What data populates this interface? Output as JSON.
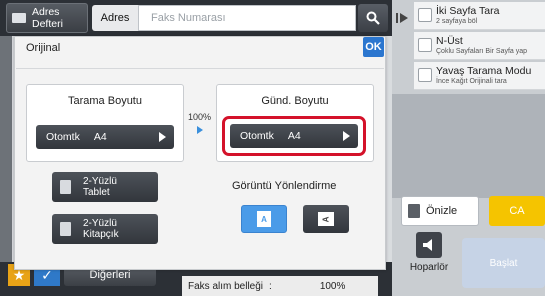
{
  "topbar": {
    "address_book_label": "Adres Defteri",
    "address_book_line1": "Adres",
    "address_book_line2": "Defteri",
    "tab_label": "Adres",
    "fax_input_placeholder": "Faks Numarası",
    "search_icon": "search-icon"
  },
  "dialog": {
    "title": "Orijinal",
    "ok_label": "OK",
    "scan_size": {
      "label": "Tarama Boyutu",
      "button_line1": "Otomtk",
      "button_line2": "A4"
    },
    "ratio": "100%",
    "send_size": {
      "label": "Günd. Boyutu",
      "button_line1": "Otomtk",
      "button_line2": "A4"
    },
    "two_sided_tablet": {
      "line1": "2-Yüzlü",
      "line2": "Tablet"
    },
    "two_sided_booklet": {
      "line1": "2-Yüzlü",
      "line2": "Kitapçık"
    },
    "orientation_label": "Görüntü Yönlendirme",
    "orientation_options": [
      "A",
      "A"
    ],
    "orientation_selected_index": 0
  },
  "rightpanel": {
    "items": [
      {
        "title": "İki Sayfa Tara",
        "subtitle": "2 sayfaya böl"
      },
      {
        "title": "N-Üst",
        "subtitle": "Çoklu Sayfaları Bir Sayfa yap"
      },
      {
        "title": "Yavaş Tarama Modu",
        "subtitle": "İnce Kağıt Orijinali tara"
      }
    ],
    "preview_label": "Önizle",
    "ca_label": "CA",
    "speaker_label": "Hoparlör",
    "start_label": "Başlat"
  },
  "bottombar": {
    "others_label": "Diğerleri",
    "fax_memory_label": "Faks alım belleği",
    "fax_memory_value": "100%"
  },
  "colors": {
    "accent_blue": "#2b76cf",
    "highlight_red": "#d4122a",
    "ca_yellow": "#f5c400",
    "star_orange": "#e8a317"
  }
}
